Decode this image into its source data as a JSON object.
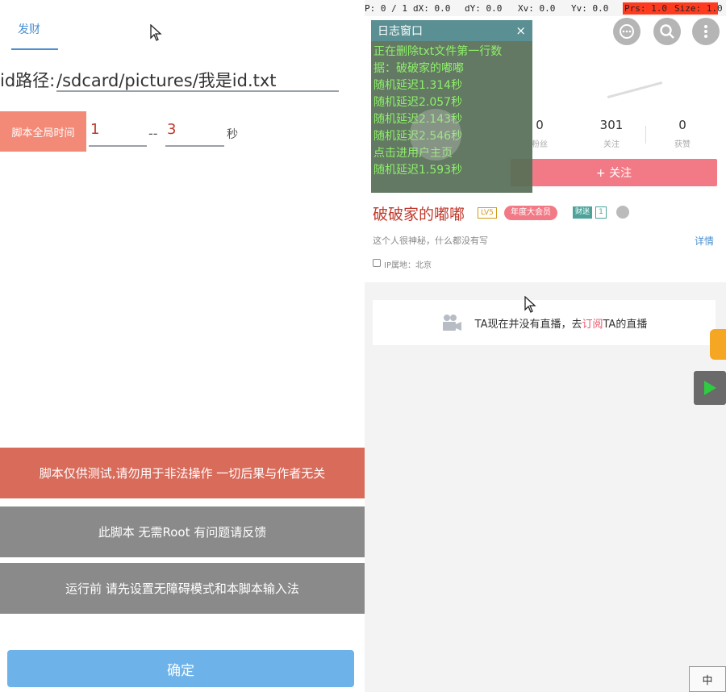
{
  "left": {
    "tab_label": "发财",
    "path_label": "id路径:",
    "path_value": "/sdcard/pictures/我是id.txt",
    "time_label": "脚本全局时间",
    "min_value": "1",
    "separator": "--",
    "max_value": "3",
    "unit": "秒",
    "notice_1": "脚本仅供测试,请勿用于非法操作 一切后果与作者无关",
    "notice_2": "此脚本 无需Root 有问题请反馈",
    "notice_3": "运行前 请先设置无障碍模式和本脚本输入法",
    "confirm_label": "确定"
  },
  "status": {
    "p": "P: 0 / 1",
    "dx": "dX: 0.0",
    "dy": "dY: 0.0",
    "xv": "Xv: 0.0",
    "yv": "Yv: 0.0",
    "prs": "Prs: 1.0",
    "size": "Size: 1.0"
  },
  "profile": {
    "stats": [
      {
        "num": "0",
        "label": "粉丝"
      },
      {
        "num": "301",
        "label": "关注"
      },
      {
        "num": "0",
        "label": "获赞"
      }
    ],
    "follow_label": "+ 关注",
    "nickname": "破破家的嘟嘟",
    "level_badge": "LV5",
    "year_badge": "年度大会员",
    "fan_badge": "财迷",
    "fan_level": "1",
    "bio": "这个人很神秘，什么都没有写",
    "detail_link": "详情",
    "ip_location": "IP属地：北京",
    "live_prefix": "TA现在并没有直播，去",
    "live_link": "订阅",
    "live_suffix": "TA的直播"
  },
  "log_window": {
    "title": "日志窗口",
    "close": "×",
    "lines": [
      "正在删除txt文件第一行数",
      "据：破破家的嘟嘟",
      "随机延迟1.314秒",
      "随机延迟2.057秒",
      "随机延迟2.143秒",
      "随机延迟2.546秒",
      "点击进用户主页",
      "随机延迟1.593秒"
    ]
  },
  "ime": {
    "label": "中"
  },
  "colors": {
    "accent_blue": "#4a8fd0",
    "notice_red": "#d96b5b",
    "notice_gray": "#8a8a8a",
    "confirm_blue": "#6db2e8",
    "follow_pink": "#f27a86",
    "log_green": "#8ef06a"
  },
  "icons": {
    "chat": "chat-bubble-icon",
    "search": "search-icon",
    "more": "more-vertical-icon",
    "camera": "camera-icon",
    "play": "play-icon",
    "pointer": "mouse-pointer-icon"
  }
}
